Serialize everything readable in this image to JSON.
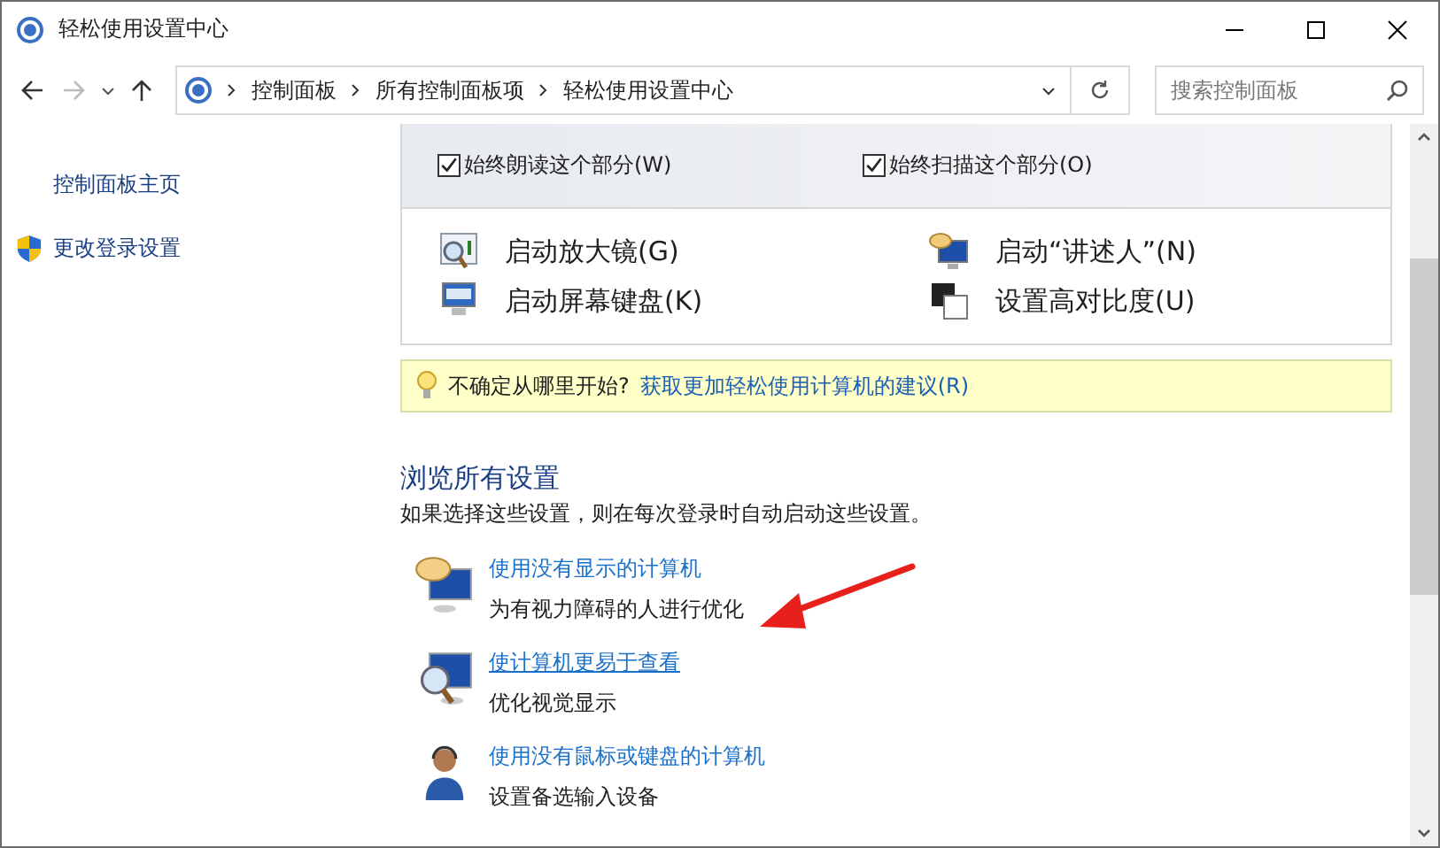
{
  "window": {
    "title": "轻松使用设置中心"
  },
  "address_bar": {
    "breadcrumbs": [
      "控制面板",
      "所有控制面板项",
      "轻松使用设置中心"
    ]
  },
  "search": {
    "placeholder": "搜索控制面板"
  },
  "sidebar": {
    "items": [
      {
        "label": "控制面板主页",
        "kind": "plain"
      },
      {
        "label": "更改登录设置",
        "kind": "shield"
      }
    ]
  },
  "options": [
    {
      "label": "始终朗读这个部分(W)",
      "checked": true
    },
    {
      "label": "始终扫描这个部分(O)",
      "checked": true
    }
  ],
  "tools": [
    {
      "label": "启动放大镜(G)",
      "kind": "magnifier"
    },
    {
      "label": "启动“讲述人”(N)",
      "kind": "narrator"
    },
    {
      "label": "启动屏幕键盘(K)",
      "kind": "keyboard"
    },
    {
      "label": "设置高对比度(U)",
      "kind": "contrast"
    }
  ],
  "tip": {
    "text": "不确定从哪里开始?",
    "link": "获取更加轻松使用计算机的建议(R)"
  },
  "browse": {
    "heading": "浏览所有设置",
    "description": "如果选择这些设置，则在每次登录时自动启动这些设置。",
    "items": [
      {
        "title": "使用没有显示的计算机",
        "subtitle": "为有视力障碍的人进行优化",
        "kind": "speech",
        "hovered": false
      },
      {
        "title": "使计算机更易于查看",
        "subtitle": "优化视觉显示",
        "kind": "magnifier",
        "hovered": true
      },
      {
        "title": "使用没有鼠标或键盘的计算机",
        "subtitle": "设置备选输入设备",
        "kind": "person",
        "hovered": false
      }
    ]
  }
}
